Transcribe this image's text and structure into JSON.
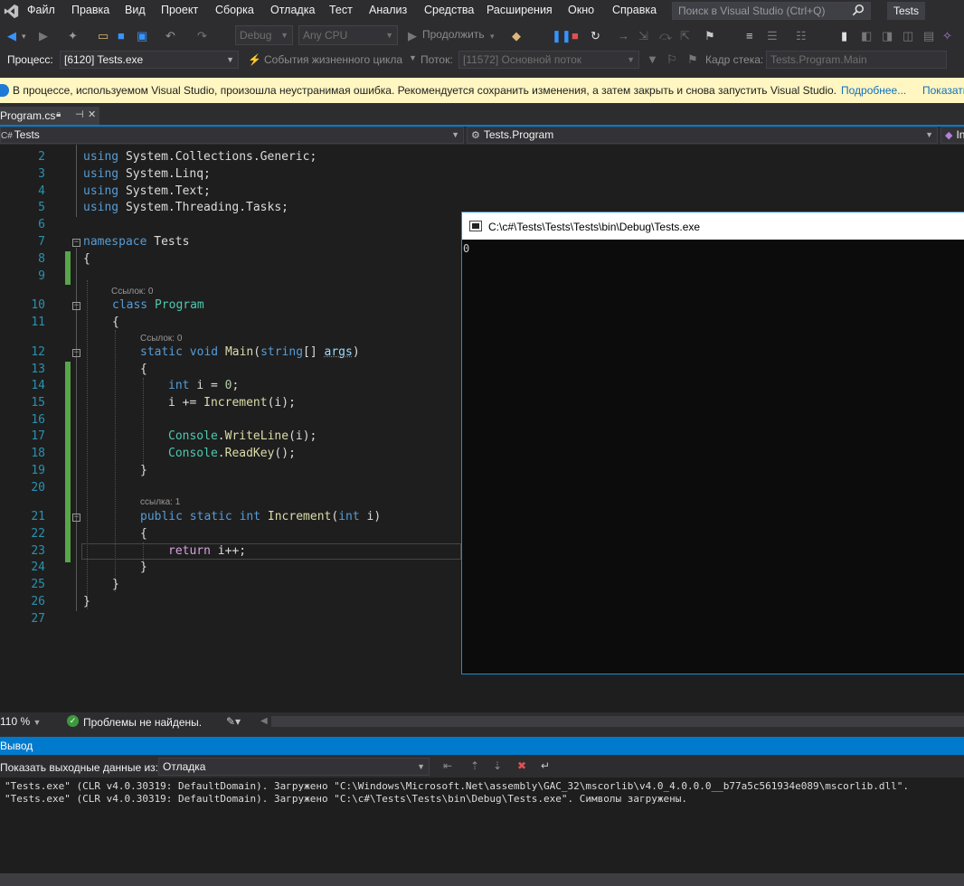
{
  "menu": {
    "items": [
      "Файл",
      "Правка",
      "Вид",
      "Проект",
      "Сборка",
      "Отладка",
      "Тест",
      "Анализ",
      "Средства",
      "Расширения",
      "Окно",
      "Справка"
    ],
    "search_placeholder": "Поиск в Visual Studio (Ctrl+Q)",
    "solution_name": "Tests"
  },
  "toolbar": {
    "config": "Debug",
    "platform": "Any CPU",
    "continue_label": "Продолжить"
  },
  "debug_location": {
    "process_label": "Процесс:",
    "process_value": "[6120] Tests.exe",
    "lifecycle_label": "События жизненного цикла",
    "thread_label": "Поток:",
    "thread_value": "[11572] Основной поток",
    "stack_label": "Кадр стека:",
    "stack_value": "Tests.Program.Main"
  },
  "infobar": {
    "message": "В процессе, используемом Visual Studio, произошла неустранимая ошибка. Рекомендуется сохранить изменения, а затем закрыть и снова запустить Visual Studio.",
    "more_link": "Подробнее...",
    "show_link": "Показать"
  },
  "doc_tab": {
    "title": "Program.cs"
  },
  "navbar": {
    "project": "Tests",
    "type": "Tests.Program",
    "member": "In"
  },
  "editor": {
    "line_numbers": [
      "2",
      "3",
      "4",
      "5",
      "6",
      "7",
      "8",
      "9",
      "10",
      "11",
      "12",
      "13",
      "14",
      "15",
      "16",
      "17",
      "18",
      "19",
      "20",
      "21",
      "22",
      "23",
      "24",
      "25",
      "26",
      "27"
    ],
    "usings": [
      "System.Collections.Generic;",
      "System.Linq;",
      "System.Text;",
      "System.Threading.Tasks;"
    ],
    "kw_using": "using",
    "kw_namespace": "namespace",
    "namespace_name": "Tests",
    "lens_class": "Ссылок: 0",
    "kw_class": "class",
    "class_name": "Program",
    "lens_main": "Ссылок: 0",
    "kw_static": "static",
    "kw_void": "void",
    "main_name": "Main",
    "kw_string": "string",
    "main_param": "args",
    "kw_int": "int",
    "var_i_decl": "i = ",
    "zero": "0",
    "line_inc": "i += ",
    "increment_name": "Increment",
    "console_type": "Console",
    "writeline": "WriteLine",
    "readkey": "ReadKey",
    "lens_inc": "ссылка: 1",
    "kw_public": "public",
    "kw_return": "return",
    "return_expr": " i++;"
  },
  "console": {
    "title": "C:\\c#\\Tests\\Tests\\Tests\\bin\\Debug\\Tests.exe",
    "output": "0"
  },
  "editor_status": {
    "zoom": "110 %",
    "problems": "Проблемы не найдены."
  },
  "output_panel": {
    "title": "Вывод",
    "show_from_label": "Показать выходные данные из:",
    "source": "Отладка",
    "lines": [
      "\"Tests.exe\" (CLR v4.0.30319: DefaultDomain). Загружено \"C:\\Windows\\Microsoft.Net\\assembly\\GAC_32\\mscorlib\\v4.0_4.0.0.0__b77a5c561934e089\\mscorlib.dll\".",
      "\"Tests.exe\" (CLR v4.0.30319: DefaultDomain). Загружено \"C:\\c#\\Tests\\Tests\\bin\\Debug\\Tests.exe\". Символы загружены."
    ]
  },
  "colors": {
    "accent": "#007acc",
    "keyword": "#569cd6",
    "type": "#4ec9b0",
    "method": "#dcdcaa",
    "line_number": "#2b91af",
    "change_bar": "#57a64a"
  }
}
